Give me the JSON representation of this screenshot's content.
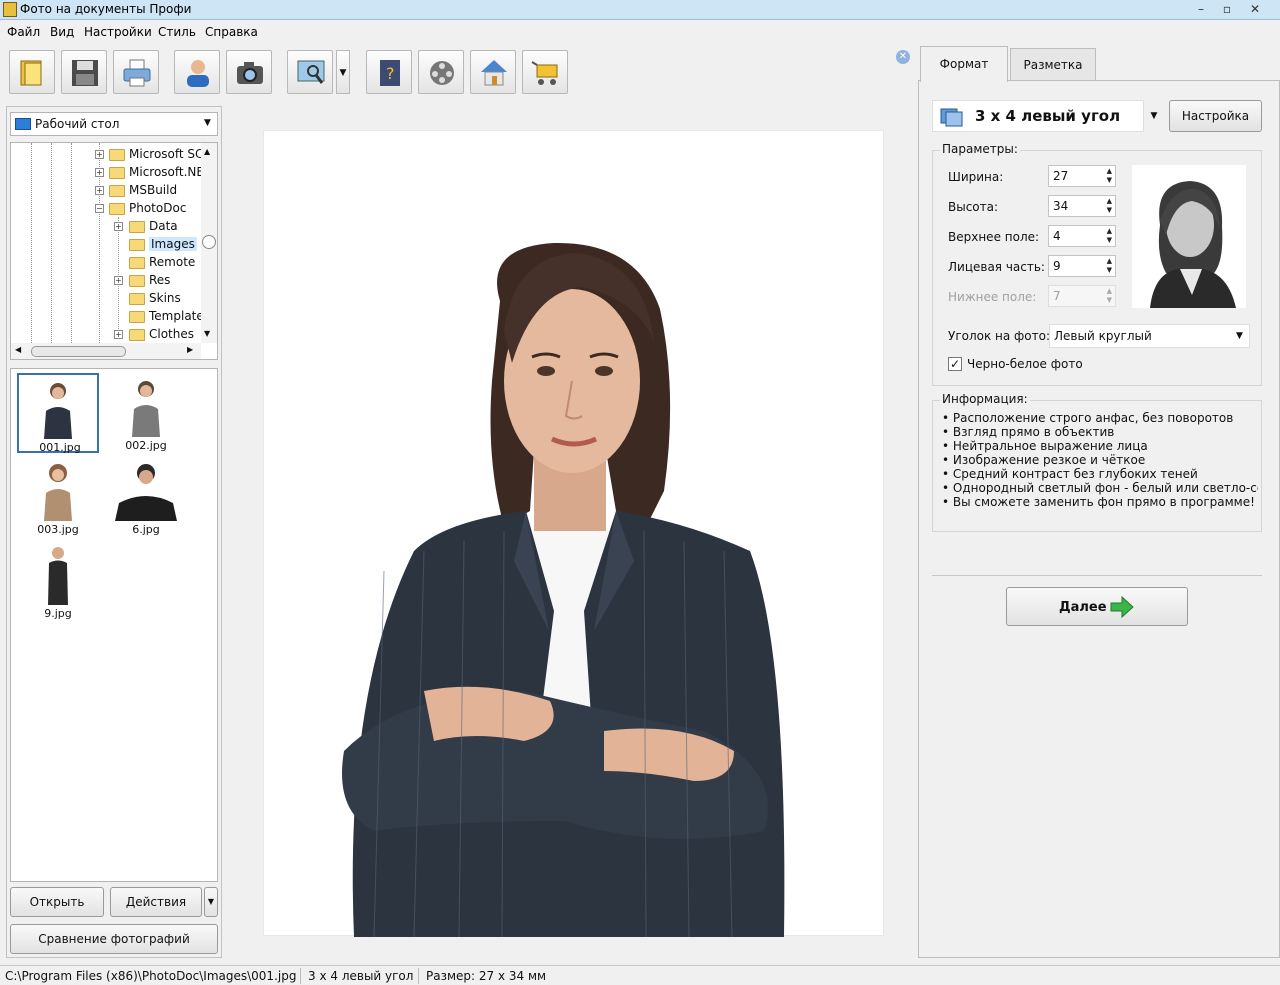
{
  "window": {
    "title": "Фото на документы Профи"
  },
  "menu": [
    "Файл",
    "Вид",
    "Настройки",
    "Стиль",
    "Справка"
  ],
  "toolbar": {
    "buttons": [
      "open-icon",
      "save-icon",
      "print-icon",
      "user-icon",
      "camera-icon",
      "image-edit-icon",
      "help-book-icon",
      "film-icon",
      "home-icon",
      "cart-icon"
    ]
  },
  "left": {
    "location": "Рабочий стол",
    "tree": [
      {
        "label": "Microsoft SC",
        "level": 0,
        "expand": "+"
      },
      {
        "label": "Microsoft.NE",
        "level": 0,
        "expand": "+"
      },
      {
        "label": "MSBuild",
        "level": 0,
        "expand": "+"
      },
      {
        "label": "PhotoDoc",
        "level": 0,
        "expand": "-"
      },
      {
        "label": "Data",
        "level": 1,
        "expand": "+"
      },
      {
        "label": "Images",
        "level": 1,
        "expand": ""
      },
      {
        "label": "Remote",
        "level": 1,
        "expand": ""
      },
      {
        "label": "Res",
        "level": 1,
        "expand": "+"
      },
      {
        "label": "Skins",
        "level": 1,
        "expand": ""
      },
      {
        "label": "Template",
        "level": 1,
        "expand": ""
      },
      {
        "label": "Clothes",
        "level": 1,
        "expand": "+"
      }
    ],
    "files": [
      "001.jpg",
      "002.jpg",
      "003.jpg",
      "6.jpg",
      "9.jpg"
    ],
    "open_button": "Открыть",
    "actions_button": "Действия",
    "compare_button": "Сравнение фотографий"
  },
  "tabs": {
    "format": "Формат",
    "layout": "Разметка"
  },
  "format": {
    "preset": "3 x 4 левый угол",
    "settings_button": "Настройка",
    "params_title": "Параметры:",
    "width_label": "Ширина:",
    "width": "27",
    "height_label": "Высота:",
    "height": "34",
    "top_label": "Верхнее поле:",
    "top": "4",
    "face_label": "Лицевая часть:",
    "face": "9",
    "bottom_label": "Нижнее поле:",
    "bottom": "7",
    "corner_label": "Уголок на фото:",
    "corner": "Левый круглый",
    "bw_label": "Черно-белое фото",
    "bw_checked": true,
    "info_title": "Информация:",
    "info": [
      "Расположение строго анфас, без поворотов",
      "Взгляд прямо в объектив",
      "Нейтральное выражение лица",
      "Изображение резкое и чёткое",
      "Средний контраст без глубоких теней",
      "Однородный светлый фон - белый или светло-сер...",
      "Вы сможете заменить фон прямо в программе!"
    ],
    "next_button": "Далее"
  },
  "status": {
    "path": "C:\\Program Files (x86)\\PhotoDoc\\Images\\001.jpg",
    "format": "3 x 4 левый угол",
    "size": "Размер: 27 x 34 мм"
  },
  "colors": {
    "accent": "#3a6fb0",
    "selection": "#cde8ff",
    "next_arrow": "#39b54a"
  }
}
